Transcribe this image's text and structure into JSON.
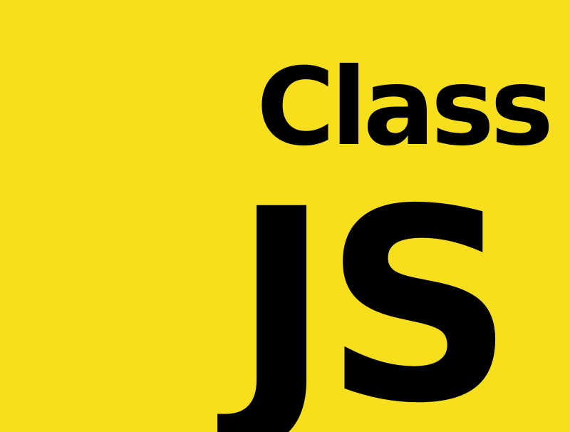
{
  "logo": {
    "line1": "Class",
    "line2": "JS",
    "background_color": "#F7DF1E",
    "text_color": "#000000"
  }
}
